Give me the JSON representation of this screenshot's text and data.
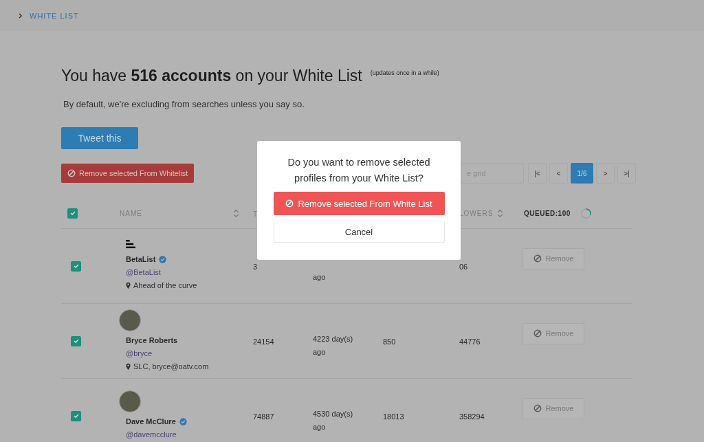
{
  "breadcrumb": {
    "label": "WHITE LIST"
  },
  "header": {
    "title": "You have **516 accounts** on your White List",
    "note": "(updates once in a while)",
    "subtitle": "By default, we're excluding from searches unless you say so."
  },
  "tweet_button": "Tweet this",
  "remove_selected_button": "Remove selected From Whitelist",
  "search": {
    "placeholder": "e grid"
  },
  "pager": [
    {
      "label": "|<",
      "selected": false
    },
    {
      "label": "<",
      "selected": false
    },
    {
      "label": "1/6",
      "selected": true
    },
    {
      "label": ">",
      "selected": false
    },
    {
      "label": ">|",
      "selected": false
    }
  ],
  "table": {
    "select_all_checked": true,
    "columns": {
      "name": "NAME",
      "column_2": "T",
      "followers": "LOWERS",
      "queued": "QUEUED:100"
    },
    "rows": [
      {
        "checked": true,
        "kind": "logo",
        "name": "BetaList",
        "verified": true,
        "handle": "@BetaList",
        "location": "Ahead of the curve",
        "tweets": "3",
        "last_tweet": [
          "ago"
        ],
        "followers": "06",
        "action": "Remove"
      },
      {
        "checked": true,
        "kind": "photo",
        "name": "Bryce Roberts",
        "verified": false,
        "handle": "@bryce",
        "location": "SLC, bryce@oatv.com",
        "tweets": "24154",
        "last_tweet": [
          "4223 day(s)",
          "ago"
        ],
        "following": "850",
        "followers": "44776",
        "action": "Remove"
      },
      {
        "checked": true,
        "kind": "photo",
        "name": "Dave McClure",
        "verified": true,
        "handle": "@davemcclure",
        "tweets": "74887",
        "last_tweet": [
          "4530 day(s)",
          "ago"
        ],
        "following": "18013",
        "followers": "358294",
        "action": "Remove"
      }
    ]
  },
  "modal": {
    "message": "Do you want to remove selected profiles from your White List?",
    "confirm": "Remove selected From White List",
    "cancel": "Cancel"
  }
}
